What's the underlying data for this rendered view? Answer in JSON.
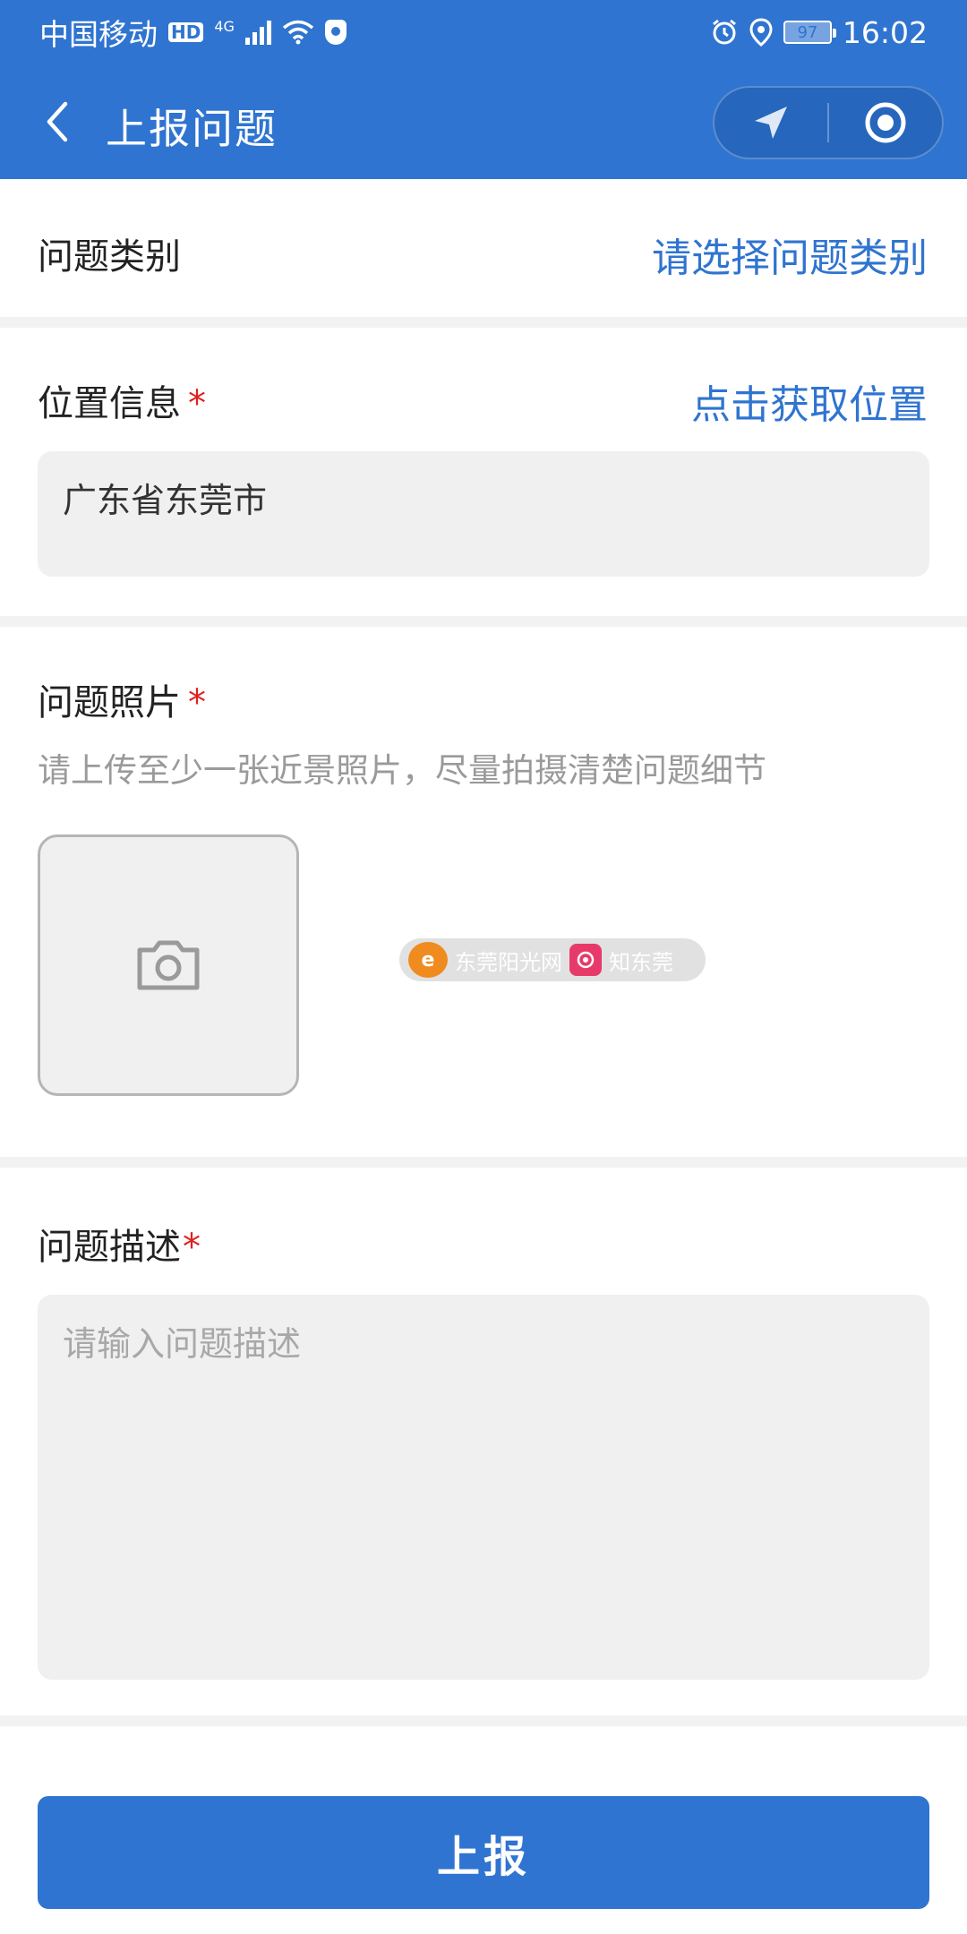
{
  "status_bar": {
    "carrier": "中国移动",
    "hd_badge": "HD",
    "network": "4G",
    "battery": "97",
    "time": "16:02"
  },
  "nav": {
    "title": "上报问题",
    "back_icon": "chevron-left-icon",
    "capsule_icons": [
      "location-arrow-icon",
      "target-circle-icon"
    ]
  },
  "category": {
    "label": "问题类别",
    "action": "请选择问题类别"
  },
  "location": {
    "label": "位置信息",
    "required": "*",
    "action": "点击获取位置",
    "value": "广东省东莞市"
  },
  "photo": {
    "label": "问题照片",
    "required": "*",
    "hint": "请上传至少一张近景照片，尽量拍摄清楚问题细节",
    "upload_icon": "camera-icon"
  },
  "watermark": {
    "brand1": "东莞阳光网",
    "brand2": "知东莞"
  },
  "description": {
    "label": "问题描述",
    "required": "*",
    "placeholder": "请输入问题描述"
  },
  "submit": {
    "label": "上报"
  },
  "colors": {
    "primary": "#2f74d0",
    "required": "#e02020",
    "background": "#f2f2f2"
  }
}
